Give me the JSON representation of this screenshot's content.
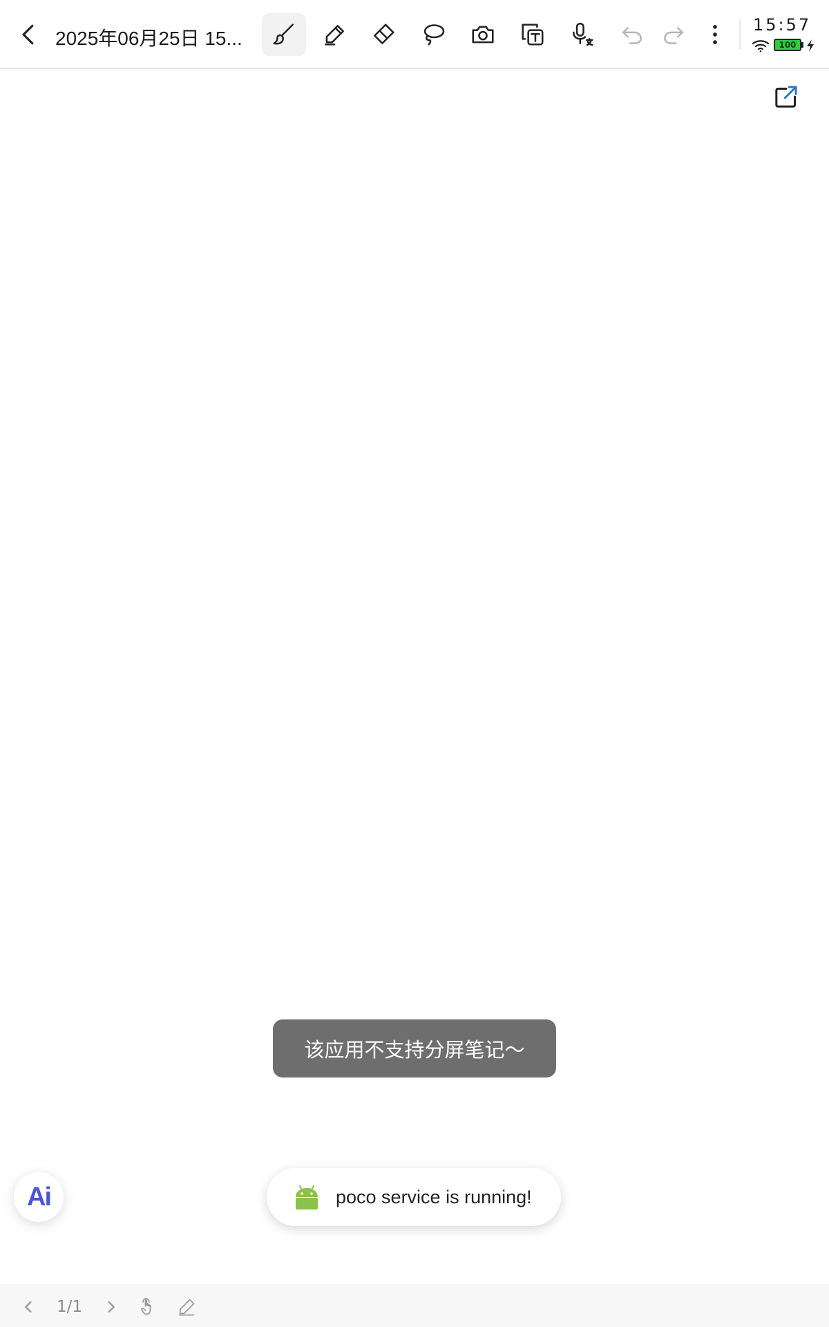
{
  "header": {
    "title": "2025年06月25日 15...",
    "tools": [
      "back-icon",
      "brush-icon",
      "highlighter-icon",
      "eraser-icon",
      "lasso-icon",
      "camera-icon",
      "text-ocr-icon",
      "voice-translate-icon",
      "undo-icon",
      "redo-icon",
      "more-icon"
    ],
    "active_tool": "brush-icon"
  },
  "status_bar": {
    "time": "15:57",
    "battery": "100"
  },
  "canvas": {
    "share_icon": "share-export-icon"
  },
  "toast": {
    "message": "该应用不支持分屏笔记～"
  },
  "ai_button": {
    "label": "Ai"
  },
  "poco_toast": {
    "message": "poco service is running!"
  },
  "bottom_bar": {
    "page_indicator": "1/1"
  },
  "colors": {
    "toast_bg": "#6e6e6e",
    "battery_fill": "#2ecc40",
    "ai_accent": "#4a55d6",
    "android_green": "#8bc34a"
  }
}
